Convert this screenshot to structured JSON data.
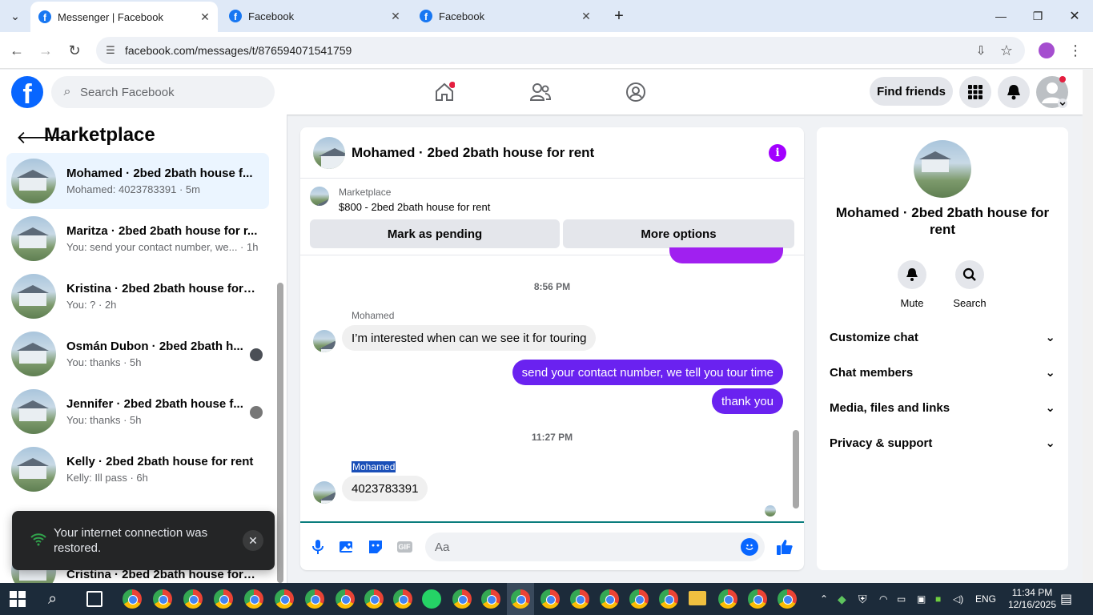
{
  "browser": {
    "tabs": [
      {
        "title": "Messenger | Facebook",
        "active": true
      },
      {
        "title": "Facebook",
        "active": false
      },
      {
        "title": "Facebook",
        "active": false
      }
    ],
    "url": "facebook.com/messages/t/876594071541759"
  },
  "header": {
    "search_placeholder": "Search Facebook",
    "find_friends": "Find friends"
  },
  "sidebar": {
    "title": "Marketplace",
    "conversations": [
      {
        "name": "Mohamed · 2bed 2bath house f...",
        "preview": "Mohamed: 4023783391 · 5m",
        "selected": true
      },
      {
        "name": "Maritza · 2bed 2bath house for r...",
        "preview": "You: send your contact number, we... · 1h"
      },
      {
        "name": "Kristina · 2bed 2bath house for r...",
        "preview": "You: ? · 2h"
      },
      {
        "name": "Osmán Dubon · 2bed 2bath h...",
        "preview": "You: thanks · 5h"
      },
      {
        "name": "Jennifer · 2bed 2bath house f...",
        "preview": "You: thanks · 5h"
      },
      {
        "name": "Kelly · 2bed 2bath house for rent",
        "preview": "Kelly: Ill pass · 6h"
      },
      {
        "name": "Cristina · 2bed 2bath house for r...",
        "preview": ""
      }
    ]
  },
  "toast": {
    "message": "Your internet connection was restored."
  },
  "chat": {
    "title": "Mohamed · 2bed 2bath house for rent",
    "marketplace_label": "Marketplace",
    "listing": "$800 - 2bed 2bath house for rent",
    "mark_pending": "Mark as pending",
    "more_options": "More options",
    "time1": "8:56 PM",
    "sender1": "Mohamed",
    "msg_in1": "I’m interested when can we see it for touring",
    "msg_out1": "send your contact number, we tell you tour time",
    "msg_out2": "thank you",
    "time2": "11:27 PM",
    "sender2": "Mohamed",
    "msg_in2": "4023783391",
    "composer_placeholder": "Aa"
  },
  "info": {
    "name": "Mohamed · 2bed 2bath house for rent",
    "mute": "Mute",
    "search": "Search",
    "sections": [
      "Customize chat",
      "Chat members",
      "Media, files and links",
      "Privacy & support"
    ]
  },
  "taskbar": {
    "lang": "ENG",
    "time": "11:34 PM",
    "date": "12/16/2025"
  }
}
